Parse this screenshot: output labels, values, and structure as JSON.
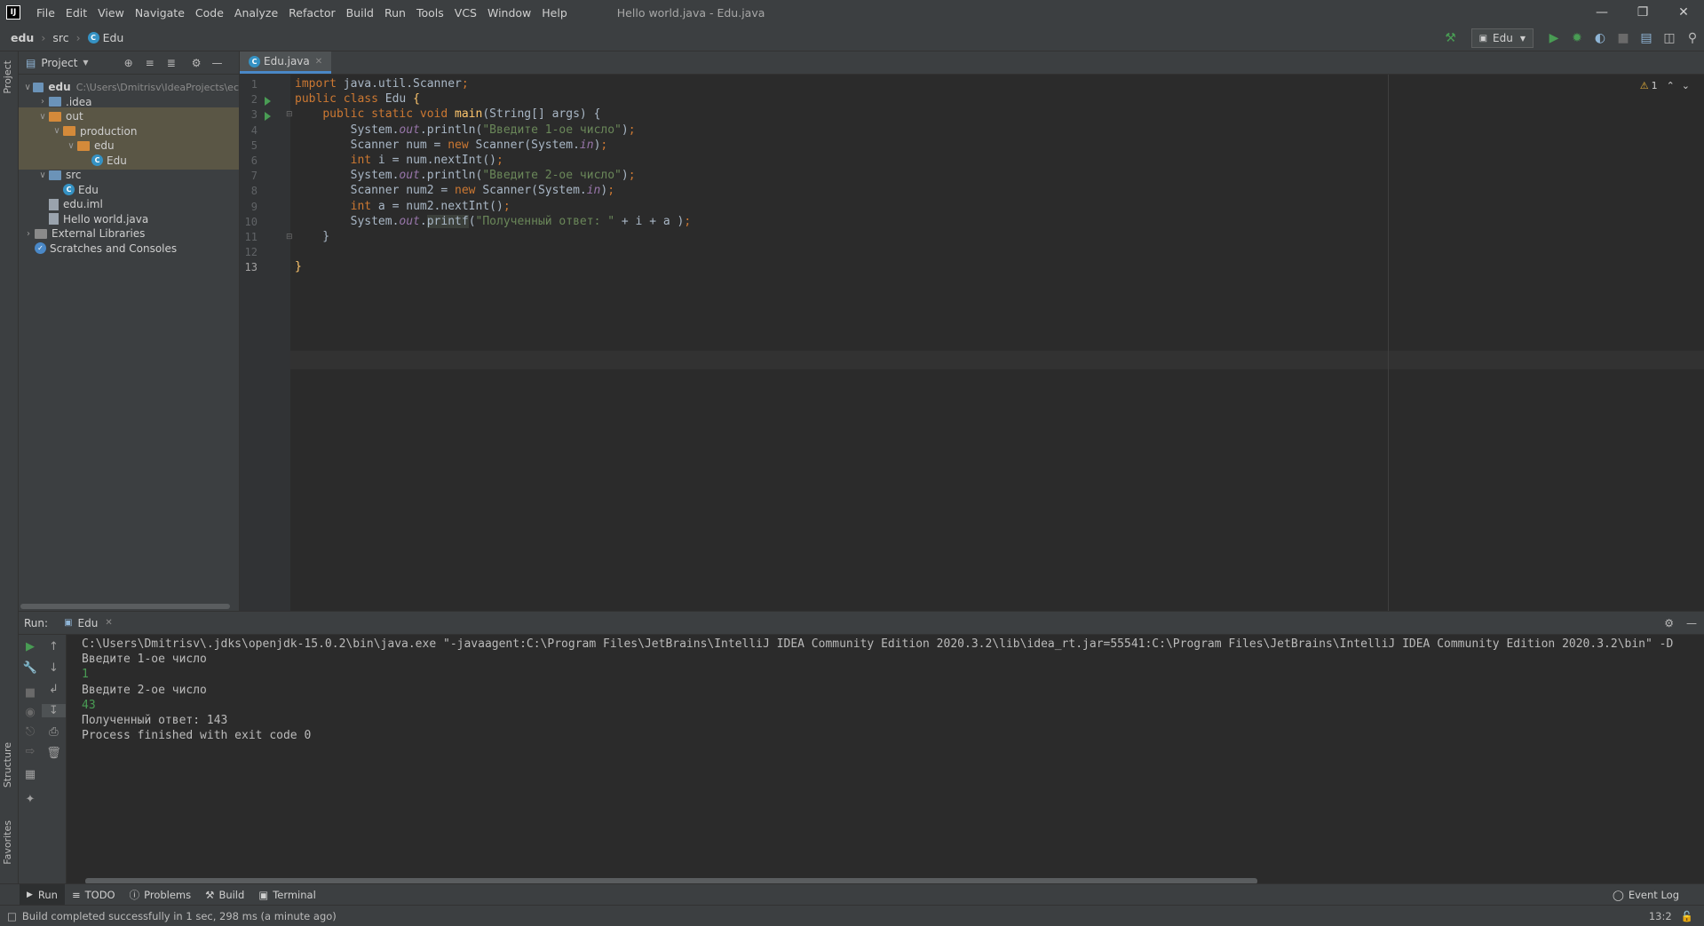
{
  "window": {
    "title": "Hello world.java - Edu.java",
    "menu": [
      "File",
      "Edit",
      "View",
      "Navigate",
      "Code",
      "Analyze",
      "Refactor",
      "Build",
      "Run",
      "Tools",
      "VCS",
      "Window",
      "Help"
    ]
  },
  "navbar": {
    "breadcrumbs": [
      "edu",
      "src",
      "Edu"
    ],
    "run_config": "Edu"
  },
  "side_tabs": {
    "project": "Project",
    "structure": "Structure",
    "favorites": "Favorites"
  },
  "project": {
    "title": "Project",
    "tree": [
      {
        "label": "edu",
        "hint": "C:\\Users\\Dmitrisv\\IdeaProjects\\ec",
        "depth": 0,
        "type": "module",
        "open": true
      },
      {
        "label": ".idea",
        "depth": 1,
        "type": "folder",
        "open": false
      },
      {
        "label": "out",
        "depth": 1,
        "type": "folder-orange",
        "open": true
      },
      {
        "label": "production",
        "depth": 2,
        "type": "folder-orange",
        "open": true
      },
      {
        "label": "edu",
        "depth": 3,
        "type": "folder-orange",
        "open": true
      },
      {
        "label": "Edu",
        "depth": 4,
        "type": "class"
      },
      {
        "label": "src",
        "depth": 1,
        "type": "folder",
        "open": true
      },
      {
        "label": "Edu",
        "depth": 2,
        "type": "class"
      },
      {
        "label": "edu.iml",
        "depth": 1,
        "type": "file"
      },
      {
        "label": "Hello world.java",
        "depth": 1,
        "type": "file"
      },
      {
        "label": "External Libraries",
        "depth": 0,
        "type": "lib",
        "open": false
      },
      {
        "label": "Scratches and Consoles",
        "depth": 0,
        "type": "scratch"
      }
    ]
  },
  "editor": {
    "tab": "Edu.java",
    "warnings": "1",
    "line_numbers": [
      "1",
      "2",
      "3",
      "4",
      "5",
      "6",
      "7",
      "8",
      "9",
      "10",
      "11",
      "12",
      "13"
    ],
    "lines": [
      [
        {
          "t": "import",
          "c": "kw"
        },
        {
          "t": " java.util.Scanner"
        },
        {
          "t": ";",
          "c": "kw"
        }
      ],
      [
        {
          "t": "public class",
          "c": "kw"
        },
        {
          "t": " Edu "
        },
        {
          "t": "{",
          "c": "fn"
        }
      ],
      [
        {
          "t": "    "
        },
        {
          "t": "public static void",
          "c": "kw"
        },
        {
          "t": " "
        },
        {
          "t": "main",
          "c": "fn"
        },
        {
          "t": "(String[] args) {"
        }
      ],
      [
        {
          "t": "        System."
        },
        {
          "t": "out",
          "c": "st"
        },
        {
          "t": ".println("
        },
        {
          "t": "\"Введите 1-ое число\"",
          "c": "str"
        },
        {
          "t": ")"
        },
        {
          "t": ";",
          "c": "kw"
        }
      ],
      [
        {
          "t": "        Scanner num = "
        },
        {
          "t": "new",
          "c": "kw"
        },
        {
          "t": " Scanner(System."
        },
        {
          "t": "in",
          "c": "st"
        },
        {
          "t": ")"
        },
        {
          "t": ";",
          "c": "kw"
        }
      ],
      [
        {
          "t": "        "
        },
        {
          "t": "int",
          "c": "kw"
        },
        {
          "t": " i = num.nextInt()"
        },
        {
          "t": ";",
          "c": "kw"
        }
      ],
      [
        {
          "t": "        System."
        },
        {
          "t": "out",
          "c": "st"
        },
        {
          "t": ".println("
        },
        {
          "t": "\"Введите 2-ое число\"",
          "c": "str"
        },
        {
          "t": ")"
        },
        {
          "t": ";",
          "c": "kw"
        }
      ],
      [
        {
          "t": "        Scanner num2 = "
        },
        {
          "t": "new",
          "c": "kw"
        },
        {
          "t": " Scanner(System."
        },
        {
          "t": "in",
          "c": "st"
        },
        {
          "t": ")"
        },
        {
          "t": ";",
          "c": "kw"
        }
      ],
      [
        {
          "t": "        "
        },
        {
          "t": "int",
          "c": "kw"
        },
        {
          "t": " a = num2.nextInt()"
        },
        {
          "t": ";",
          "c": "kw"
        }
      ],
      [
        {
          "t": "        System."
        },
        {
          "t": "out",
          "c": "st"
        },
        {
          "t": "."
        },
        {
          "t": "printf",
          "c": "hl"
        },
        {
          "t": "("
        },
        {
          "t": "\"Полученный ответ: \"",
          "c": "str"
        },
        {
          "t": " + i + a )"
        },
        {
          "t": ";",
          "c": "kw"
        }
      ],
      [
        {
          "t": "    }"
        }
      ],
      [
        {
          "t": ""
        }
      ],
      [
        {
          "t": "}",
          "c": "fn"
        }
      ]
    ]
  },
  "run": {
    "label": "Run:",
    "tab": "Edu",
    "console": [
      {
        "text": "C:\\Users\\Dmitrisv\\.jdks\\openjdk-15.0.2\\bin\\java.exe \"-javaagent:C:\\Program Files\\JetBrains\\IntelliJ IDEA Community Edition 2020.3.2\\lib\\idea_rt.jar=55541:C:\\Program Files\\JetBrains\\IntelliJ IDEA Community Edition 2020.3.2\\bin\" -D",
        "kind": "out"
      },
      {
        "text": "Введите 1-ое число",
        "kind": "out"
      },
      {
        "text": "1",
        "kind": "input"
      },
      {
        "text": "Введите 2-ое число",
        "kind": "out"
      },
      {
        "text": "43",
        "kind": "input"
      },
      {
        "text": "Полученный ответ: 143",
        "kind": "out"
      },
      {
        "text": "Process finished with exit code 0",
        "kind": "out"
      }
    ]
  },
  "bottom_tabs": [
    "Run",
    "TODO",
    "Problems",
    "Build",
    "Terminal"
  ],
  "event_log": "Event Log",
  "status": {
    "message": "Build completed successfully in 1 sec, 298 ms (a minute ago)",
    "position": "13:2"
  }
}
